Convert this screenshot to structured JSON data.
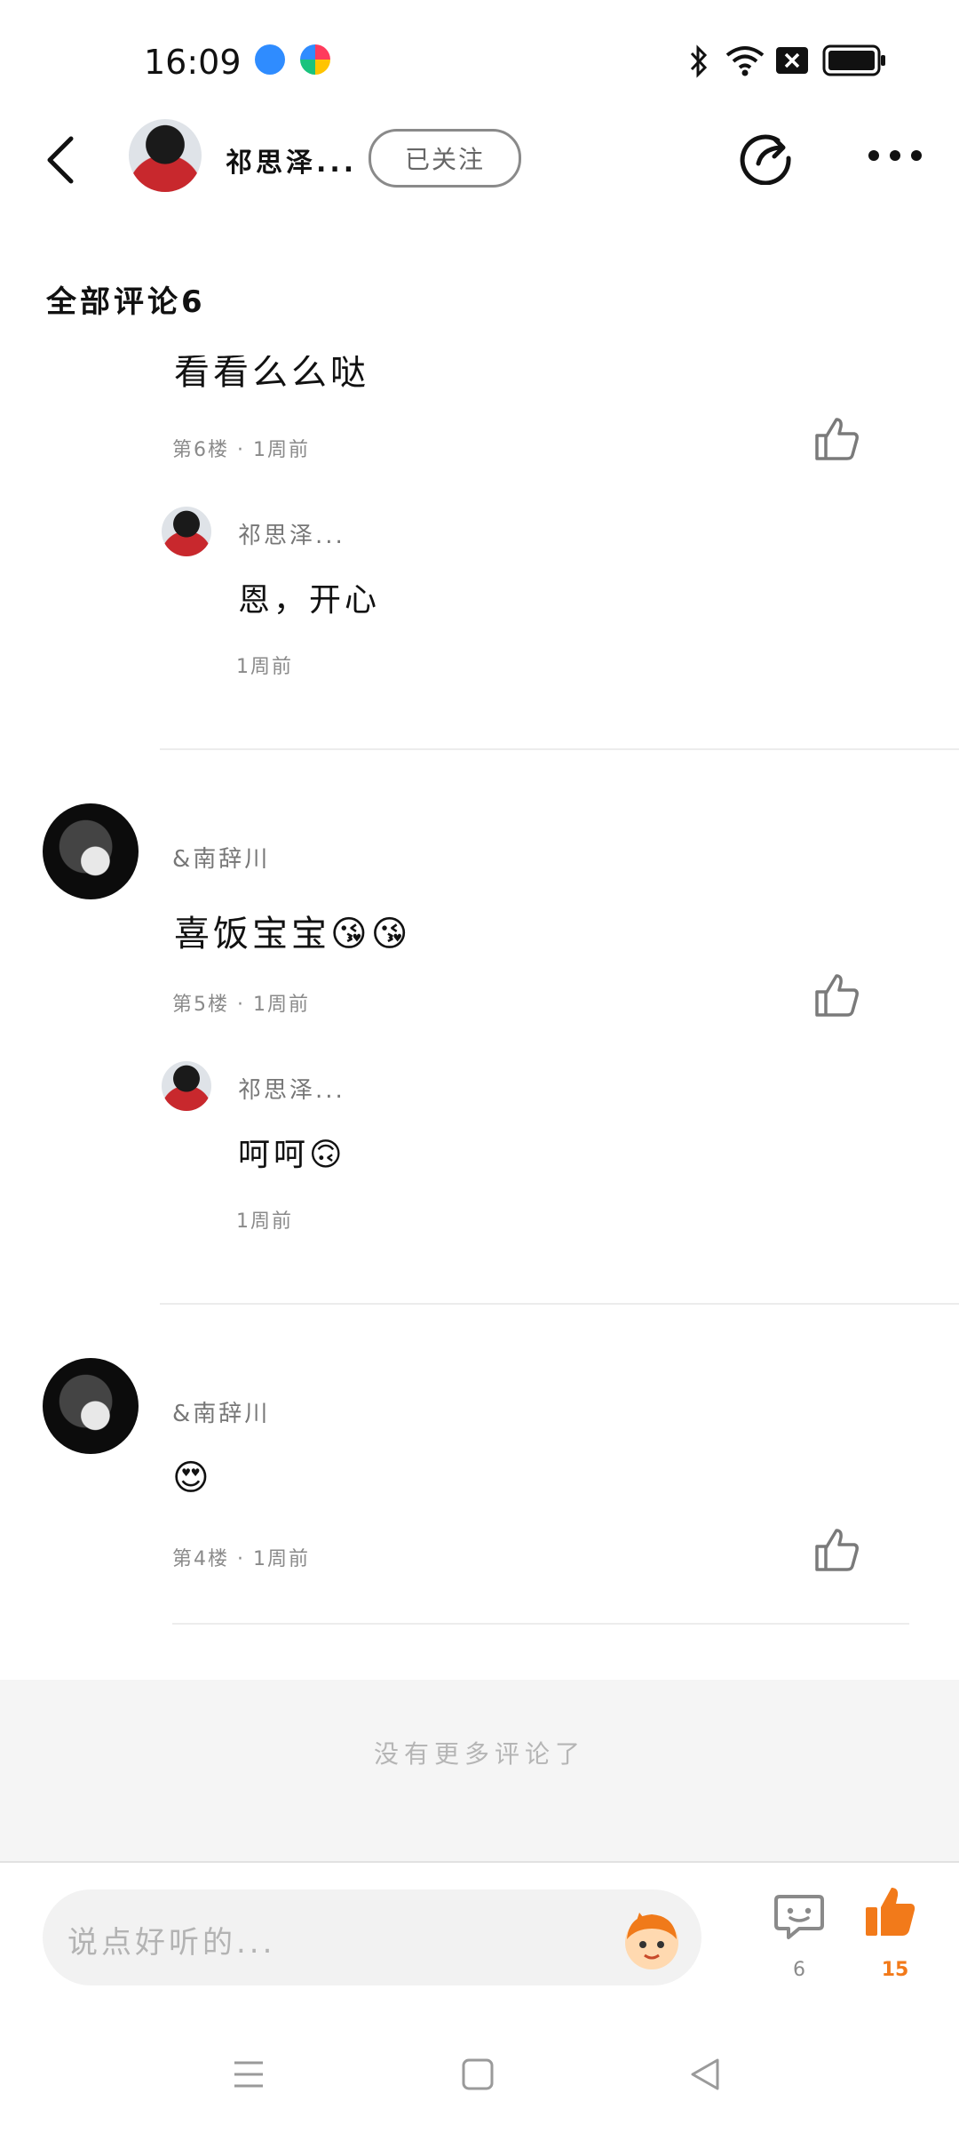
{
  "status_bar": {
    "time": "16:09"
  },
  "header": {
    "username": "祁思泽...",
    "follow_label": "已关注",
    "icons": [
      "back-arrow-icon",
      "share-icon",
      "more-icon"
    ]
  },
  "section_title": "全部评论6",
  "comments": [
    {
      "id": "c6",
      "text_partial": "看看么么哒",
      "meta": "第6楼 · 1周前",
      "reply": {
        "name": "祁思泽...",
        "text": "恩，开心",
        "time": "1周前"
      }
    },
    {
      "id": "c5",
      "name": "&南辞川",
      "text": "喜饭宝宝😘😘",
      "meta": "第5楼 · 1周前",
      "reply": {
        "name": "祁思泽...",
        "text": "呵呵🙃",
        "time": "1周前"
      }
    },
    {
      "id": "c4",
      "name": "&南辞川",
      "text": "😍",
      "meta": "第4楼 · 1周前"
    }
  ],
  "footer_note": "没有更多评论了",
  "bottom_bar": {
    "input_placeholder": "说点好听的...",
    "comment_count": "6",
    "like_count": "15",
    "like_color": "#f27a1a"
  }
}
